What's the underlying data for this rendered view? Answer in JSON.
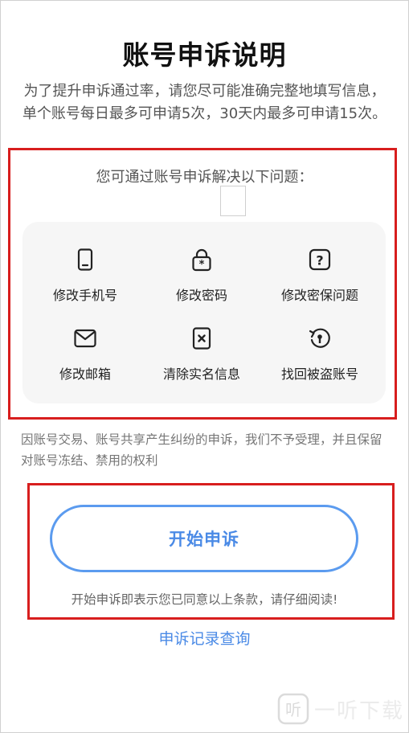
{
  "header": {
    "title": "账号申诉说明",
    "description": "为了提升申诉通过率，请您尽可能准确完整地填写信息，单个账号每日最多可申请5次，30天内最多可申请15次。"
  },
  "issues": {
    "subtitle": "您可通过账号申诉解决以下问题：",
    "items": [
      {
        "label": "修改手机号",
        "icon": "phone-icon"
      },
      {
        "label": "修改密码",
        "icon": "lock-icon"
      },
      {
        "label": "修改密保问题",
        "icon": "question-icon"
      },
      {
        "label": "修改邮箱",
        "icon": "mail-icon"
      },
      {
        "label": "清除实名信息",
        "icon": "id-clear-icon"
      },
      {
        "label": "找回被盗账号",
        "icon": "recover-icon"
      }
    ]
  },
  "notice": "因账号交易、账号共享产生纠纷的申诉，我们不予受理，并且保留对账号冻结、禁用的权利",
  "action": {
    "start_label": "开始申诉",
    "agreement": "开始申诉即表示您已同意以上条款，请仔细阅读!",
    "records_link": "申诉记录查询"
  },
  "watermark": {
    "text": "一听下载",
    "logo_char": "听"
  },
  "colors": {
    "accent": "#4a8ae6",
    "highlight_border": "#d81e1e",
    "panel_bg": "#f6f6f6"
  }
}
